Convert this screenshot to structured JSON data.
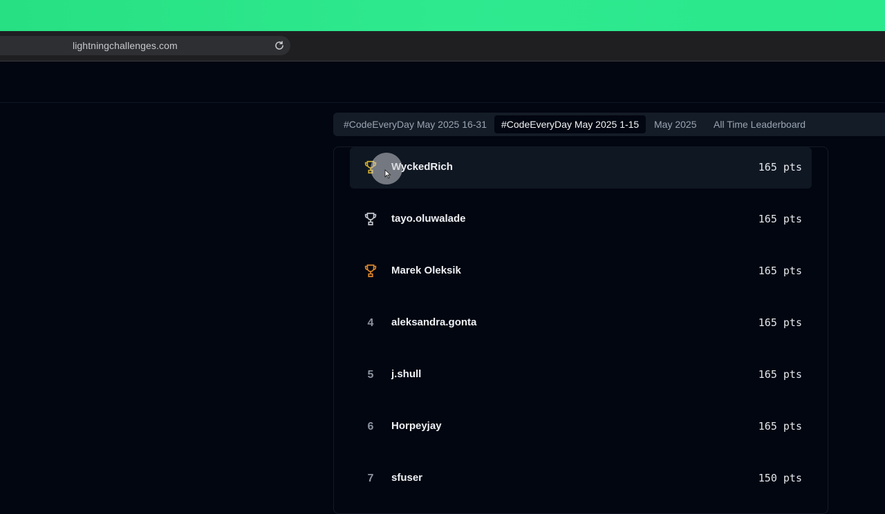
{
  "browser": {
    "url": "lightningchallenges.com",
    "reload_icon": "reload-icon"
  },
  "tabs": [
    {
      "label": "#CodeEveryDay May 2025 16-31",
      "active": false
    },
    {
      "label": "#CodeEveryDay May 2025 1-15",
      "active": true
    },
    {
      "label": "May 2025",
      "active": false
    },
    {
      "label": "All Time Leaderboard",
      "active": false
    }
  ],
  "leaderboard": [
    {
      "rank": "1",
      "name": "WyckedRich",
      "points": "165 pts",
      "icon": "trophy-gold-icon"
    },
    {
      "rank": "2",
      "name": "tayo.oluwalade",
      "points": "165 pts",
      "icon": "trophy-silver-icon"
    },
    {
      "rank": "3",
      "name": "Marek Oleksik",
      "points": "165 pts",
      "icon": "trophy-bronze-icon"
    },
    {
      "rank": "4",
      "name": "aleksandra.gonta",
      "points": "165 pts"
    },
    {
      "rank": "5",
      "name": "j.shull",
      "points": "165 pts"
    },
    {
      "rank": "6",
      "name": "Horpeyjay",
      "points": "165 pts"
    },
    {
      "rank": "7",
      "name": "sfuser",
      "points": "150 pts"
    }
  ],
  "colors": {
    "accent_green": "#2fe98f",
    "gold": "#d4b02a",
    "silver": "#c7ccd3",
    "bronze": "#e0882b"
  }
}
